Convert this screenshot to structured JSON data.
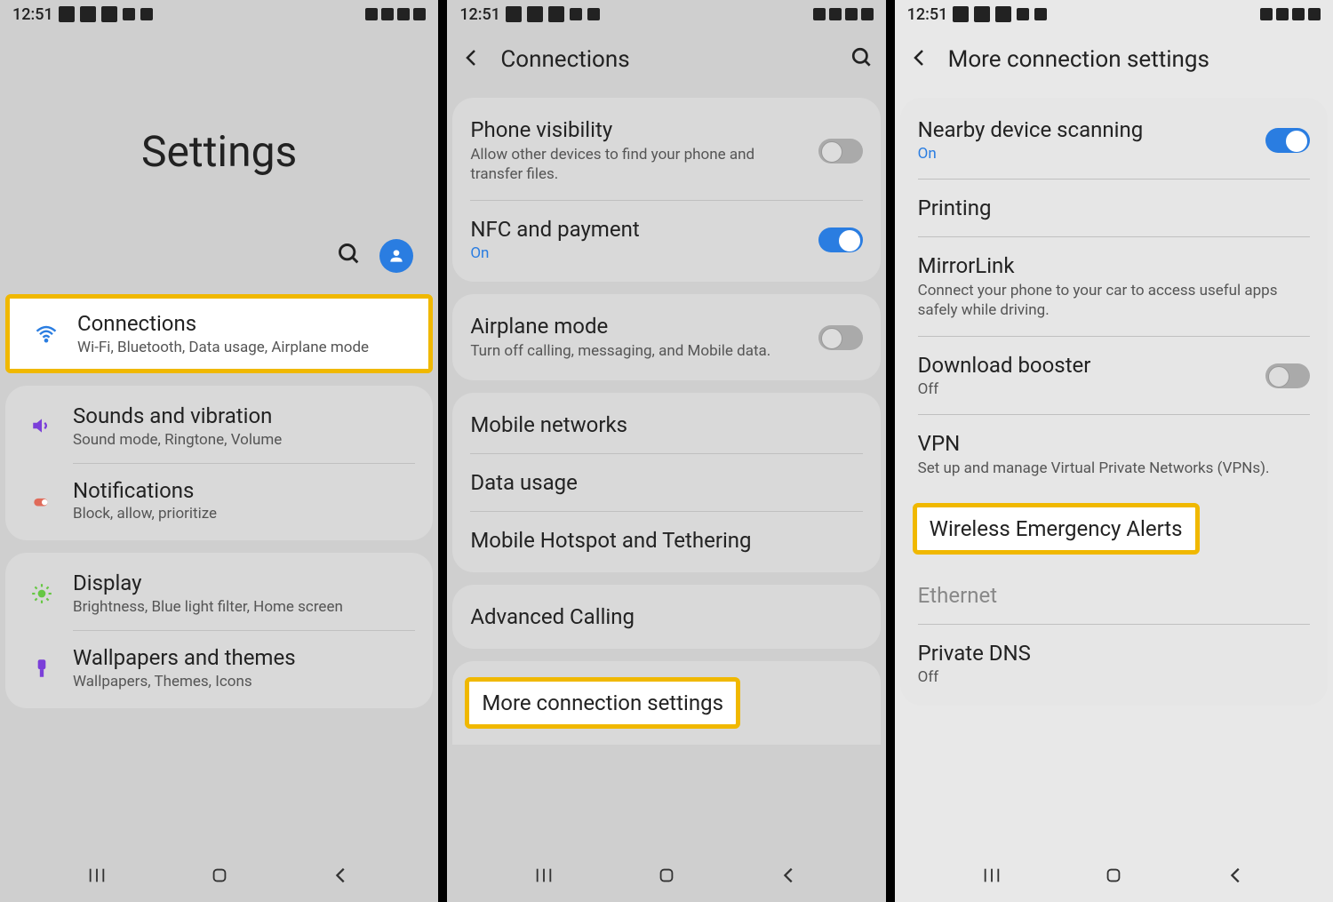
{
  "status": {
    "time": "12:51"
  },
  "screen1": {
    "title": "Settings",
    "items": [
      {
        "title": "Connections",
        "sub": "Wi-Fi, Bluetooth, Data usage, Airplane mode",
        "iconColor": "#2a7de1",
        "highlighted": true
      },
      {
        "title": "Sounds and vibration",
        "sub": "Sound mode, Ringtone, Volume",
        "iconColor": "#7b3fd9"
      },
      {
        "title": "Notifications",
        "sub": "Block, allow, prioritize",
        "iconColor": "#e06b5a"
      },
      {
        "title": "Display",
        "sub": "Brightness, Blue light filter, Home screen",
        "iconColor": "#66c744"
      },
      {
        "title": "Wallpapers and themes",
        "sub": "Wallpapers, Themes, Icons",
        "iconColor": "#7b3fd9"
      }
    ]
  },
  "screen2": {
    "headerTitle": "Connections",
    "groups": [
      [
        {
          "title": "Phone visibility",
          "sub": "Allow other devices to find your phone and transfer files.",
          "toggle": "off"
        },
        {
          "title": "NFC and payment",
          "status": "On",
          "toggle": "on"
        }
      ],
      [
        {
          "title": "Airplane mode",
          "sub": "Turn off calling, messaging, and Mobile data.",
          "toggle": "off"
        }
      ],
      [
        {
          "title": "Mobile networks"
        },
        {
          "title": "Data usage"
        },
        {
          "title": "Mobile Hotspot and Tethering"
        }
      ],
      [
        {
          "title": "Advanced Calling"
        }
      ],
      [
        {
          "title": "More connection settings",
          "highlighted": true
        }
      ]
    ]
  },
  "screen3": {
    "headerTitle": "More connection settings",
    "items": [
      {
        "title": "Nearby device scanning",
        "status": "On",
        "toggle": "on"
      },
      {
        "title": "Printing"
      },
      {
        "title": "MirrorLink",
        "sub": "Connect your phone to your car to access useful apps safely while driving."
      },
      {
        "title": "Download booster",
        "status": "Off",
        "statusClass": "off",
        "toggle": "off"
      },
      {
        "title": "VPN",
        "sub": "Set up and manage Virtual Private Networks (VPNs)."
      },
      {
        "title": "Wireless Emergency Alerts",
        "highlighted": true
      },
      {
        "title": "Ethernet",
        "disabled": true
      },
      {
        "title": "Private DNS",
        "status": "Off",
        "statusClass": "off"
      }
    ]
  }
}
